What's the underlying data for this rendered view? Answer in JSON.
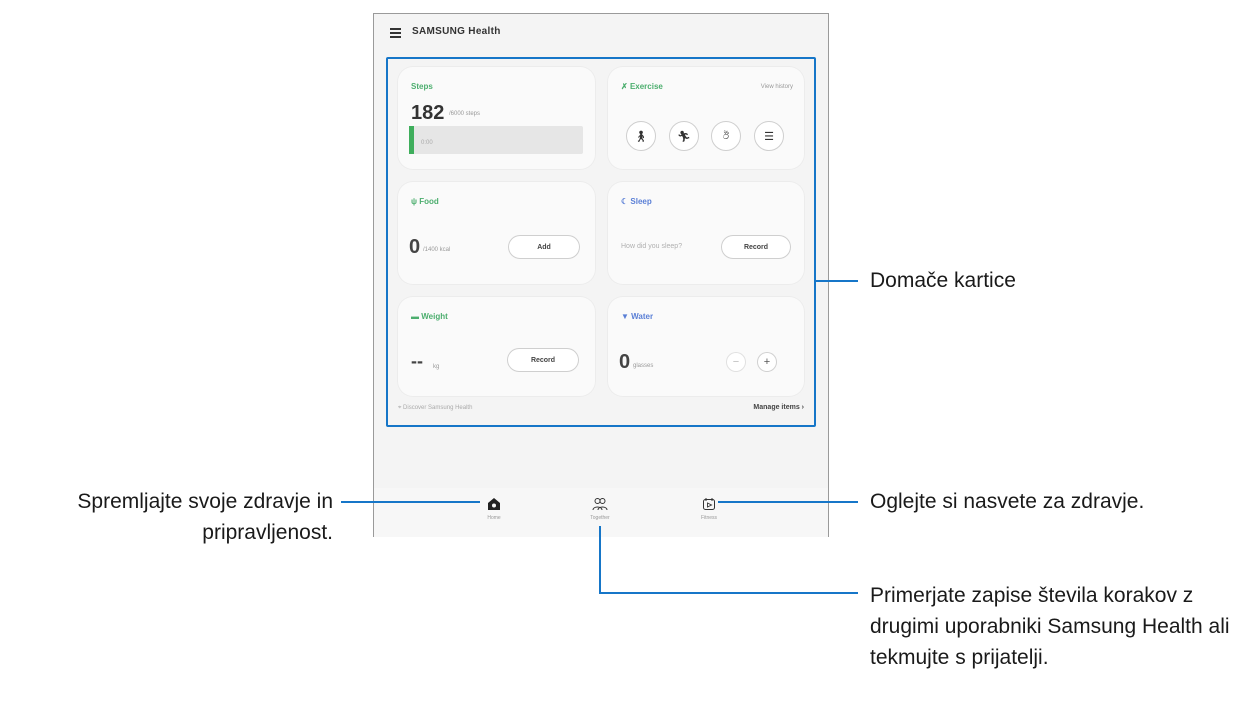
{
  "app": {
    "title": "SAMSUNG Health"
  },
  "cards": {
    "steps": {
      "title": "Steps",
      "value": "182",
      "unit": "/6000 steps",
      "bar_label": "0:00",
      "progress": 0.03
    },
    "exercise": {
      "title": "Exercise",
      "link": "View history",
      "buttons": [
        "walking-icon",
        "running-icon",
        "cycling-icon",
        "list-icon"
      ]
    },
    "food": {
      "title": "Food",
      "value": "0",
      "unit": "/1400 kcal",
      "button": "Add"
    },
    "sleep": {
      "title": "Sleep",
      "prompt": "How did you sleep?",
      "button": "Record"
    },
    "weight": {
      "title": "Weight",
      "value": "--",
      "unit": "kg",
      "button": "Record"
    },
    "water": {
      "title": "Water",
      "value": "0",
      "unit": "glasses",
      "minus": "−",
      "plus": "+"
    }
  },
  "footer": {
    "left": "Discover Samsung Health",
    "right": "Manage items"
  },
  "nav": [
    {
      "label": "Home",
      "icon": "home-icon"
    },
    {
      "label": "Together",
      "icon": "people-icon"
    },
    {
      "label": "Fitness",
      "icon": "play-calendar-icon"
    }
  ],
  "callouts": {
    "home_cards": "Domače kartice",
    "track": "Spremljajte svoje zdravje in pripravljenost.",
    "tips": "Oglejte si nasvete za zdravje.",
    "together": "Primerjate zapise števila korakov z drugimi uporabniki Samsung Health ali tekmujte s prijatelji."
  },
  "colors": {
    "accent": "#1676c8",
    "green": "#3fae5c",
    "blue": "#5a7fd6"
  }
}
